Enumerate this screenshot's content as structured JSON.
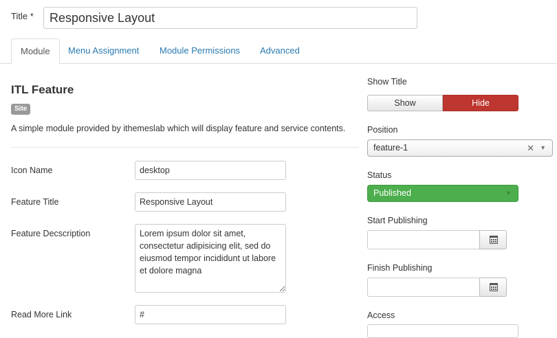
{
  "title_field": {
    "label": "Title *",
    "value": "Responsive Layout"
  },
  "tabs": [
    {
      "label": "Module",
      "active": true
    },
    {
      "label": "Menu Assignment",
      "active": false
    },
    {
      "label": "Module Permissions",
      "active": false
    },
    {
      "label": "Advanced",
      "active": false
    }
  ],
  "module": {
    "name": "ITL Feature",
    "badge": "Site",
    "description": "A simple module provided by ithemeslab which will display feature and service contents."
  },
  "fields": {
    "icon_name": {
      "label": "Icon Name",
      "value": "desktop"
    },
    "feature_title": {
      "label": "Feature Title",
      "value": "Responsive Layout"
    },
    "feature_description": {
      "label": "Feature Decscription",
      "value": "Lorem ipsum dolor sit amet, consectetur adipisicing elit, sed do eiusmod tempor incididunt ut labore et dolore magna"
    },
    "read_more_link": {
      "label": "Read More Link",
      "value": "#"
    }
  },
  "sidebar": {
    "show_title": {
      "label": "Show Title",
      "show_label": "Show",
      "hide_label": "Hide",
      "selected": "Hide"
    },
    "position": {
      "label": "Position",
      "value": "feature-1",
      "clear_glyph": "✕",
      "arrow_glyph": "▼"
    },
    "status": {
      "label": "Status",
      "value": "Published",
      "arrow_glyph": "▼"
    },
    "start_publishing": {
      "label": "Start Publishing",
      "value": ""
    },
    "finish_publishing": {
      "label": "Finish Publishing",
      "value": ""
    },
    "access": {
      "label": "Access"
    }
  },
  "colors": {
    "link": "#2a7ab0",
    "hide_active": "#bd362f",
    "published": "#4cae4c",
    "badge": "#999999"
  }
}
